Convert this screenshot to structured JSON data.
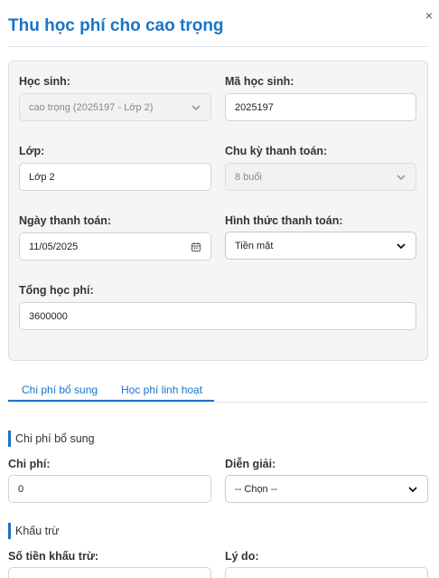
{
  "modal": {
    "title": "Thu học phí cho cao trọng",
    "close_glyph": "×"
  },
  "student_info": {
    "student_label": "Học sinh:",
    "student_value": "cao trọng (2025197 - Lớp 2)",
    "student_code_label": "Mã học sinh:",
    "student_code_value": "2025197",
    "class_label": "Lớp:",
    "class_value": "Lớp 2",
    "payment_cycle_label": "Chu kỳ thanh toán:",
    "payment_cycle_value": "8 buổi",
    "payment_date_label": "Ngày thanh toán:",
    "payment_date_value": "11/05/2025",
    "payment_method_label": "Hình thức thanh toán:",
    "payment_method_value": "Tiền mặt",
    "total_fee_label": "Tổng học phí:",
    "total_fee_value": "3600000"
  },
  "tabs": [
    {
      "label": "Chi phí bổ sung",
      "active": true
    },
    {
      "label": "Học phí linh hoạt",
      "active": false
    }
  ],
  "extra_cost": {
    "section_title": "Chi phí bổ sung",
    "cost_label": "Chi phí:",
    "cost_value": "0",
    "description_label": "Diễn giải:",
    "description_value": "-- Chọn --"
  },
  "deduction": {
    "section_title": "Khấu trừ",
    "amount_label": "Số tiền khấu trừ:",
    "reason_label": "Lý do:"
  },
  "colors": {
    "accent": "#1a73c8",
    "panel_bg": "#f5f5f5",
    "disabled_bg": "#f2f2f2"
  }
}
